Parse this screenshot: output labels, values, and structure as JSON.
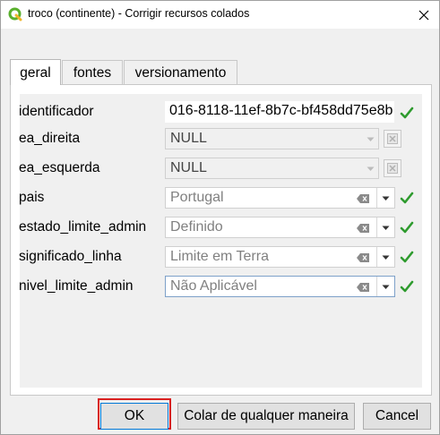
{
  "window": {
    "title": "troco (continente) - Corrigir recursos colados"
  },
  "tabs": [
    {
      "label": "geral",
      "active": true
    },
    {
      "label": "fontes",
      "active": false
    },
    {
      "label": "versionamento",
      "active": false
    }
  ],
  "fields": [
    {
      "label": "identificador",
      "value": "016-8118-11ef-8b7c-bf458dd75e8b",
      "status": "ok"
    },
    {
      "label": "ea_direita",
      "value": "NULL",
      "status": "disabled"
    },
    {
      "label": "ea_esquerda",
      "value": "NULL",
      "status": "disabled"
    },
    {
      "label": "pais",
      "value": "Portugal",
      "status": "ok"
    },
    {
      "label": "estado_limite_admin",
      "value": "Definido",
      "status": "ok"
    },
    {
      "label": "significado_linha",
      "value": "Limite em Terra",
      "status": "ok"
    },
    {
      "label": "nivel_limite_admin",
      "value": "Não Aplicável",
      "status": "ok"
    }
  ],
  "buttons": {
    "ok": "OK",
    "paste_anyway": "Colar de qualquer maneira",
    "cancel": "Cancel"
  },
  "colors": {
    "check_green": "#2e9b2e",
    "highlight_red": "#d92020",
    "focus_blue": "#0078d7"
  }
}
